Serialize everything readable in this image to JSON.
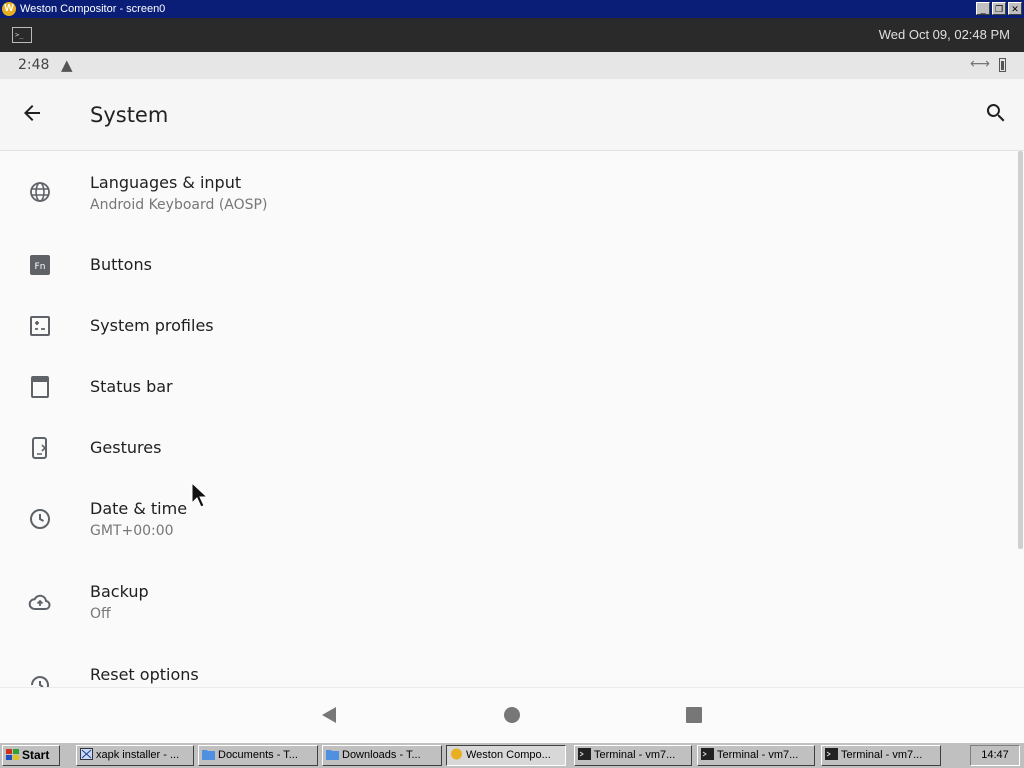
{
  "window": {
    "title": "Weston Compositor - screen0",
    "logo_letter": "W",
    "minimize": "_",
    "restore": "❐",
    "close": "✕"
  },
  "panel": {
    "clock": "Wed Oct 09, 02:48 PM"
  },
  "status": {
    "time": "2:48"
  },
  "appbar": {
    "title": "System"
  },
  "items": [
    {
      "title": "Languages & input",
      "subtitle": "Android Keyboard (AOSP)",
      "icon": "globe-icon"
    },
    {
      "title": "Buttons",
      "subtitle": "",
      "icon": "fn-key-icon",
      "icon_text": "Fn"
    },
    {
      "title": "System profiles",
      "subtitle": "",
      "icon": "profiles-icon"
    },
    {
      "title": "Status bar",
      "subtitle": "",
      "icon": "status-bar-icon"
    },
    {
      "title": "Gestures",
      "subtitle": "",
      "icon": "gestures-icon"
    },
    {
      "title": "Date & time",
      "subtitle": "GMT+00:00",
      "icon": "clock-icon"
    },
    {
      "title": "Backup",
      "subtitle": "Off",
      "icon": "cloud-upload-icon"
    },
    {
      "title": "Reset options",
      "subtitle": "",
      "icon": "history-icon"
    }
  ],
  "taskbar": {
    "start": "Start",
    "buttons": [
      {
        "label": "xapk installer - ...",
        "icon": "app-icon"
      },
      {
        "label": "Documents - T...",
        "icon": "folder-icon"
      },
      {
        "label": "Downloads - T...",
        "icon": "folder-icon"
      },
      {
        "label": "Weston Compo...",
        "icon": "weston-icon",
        "active": true
      },
      {
        "label": "Terminal - vm7...",
        "icon": "terminal-icon"
      },
      {
        "label": "Terminal - vm7...",
        "icon": "terminal-icon"
      },
      {
        "label": "Terminal - vm7...",
        "icon": "terminal-icon"
      }
    ],
    "clock": "14:47"
  },
  "colors": {
    "accent": "#0a1e78",
    "icon": "#5f6368"
  }
}
